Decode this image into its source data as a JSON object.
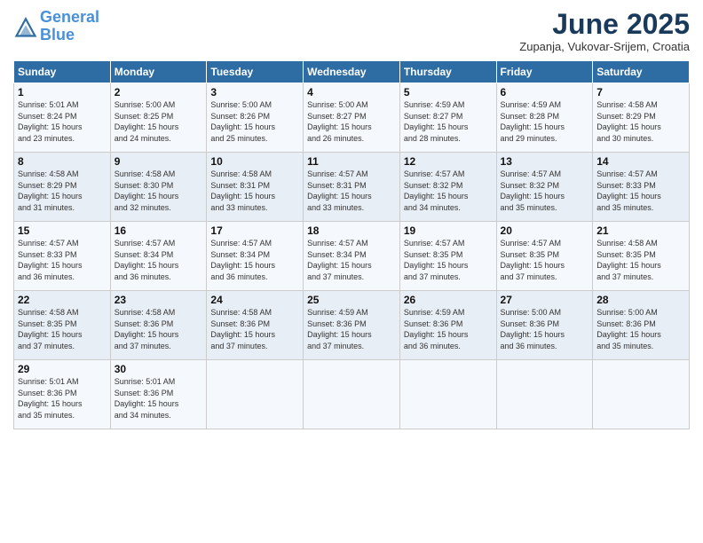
{
  "header": {
    "logo_line1": "General",
    "logo_line2": "Blue",
    "month": "June 2025",
    "location": "Zupanja, Vukovar-Srijem, Croatia"
  },
  "days_of_week": [
    "Sunday",
    "Monday",
    "Tuesday",
    "Wednesday",
    "Thursday",
    "Friday",
    "Saturday"
  ],
  "weeks": [
    [
      {
        "day": "1",
        "info": "Sunrise: 5:01 AM\nSunset: 8:24 PM\nDaylight: 15 hours\nand 23 minutes."
      },
      {
        "day": "2",
        "info": "Sunrise: 5:00 AM\nSunset: 8:25 PM\nDaylight: 15 hours\nand 24 minutes."
      },
      {
        "day": "3",
        "info": "Sunrise: 5:00 AM\nSunset: 8:26 PM\nDaylight: 15 hours\nand 25 minutes."
      },
      {
        "day": "4",
        "info": "Sunrise: 5:00 AM\nSunset: 8:27 PM\nDaylight: 15 hours\nand 26 minutes."
      },
      {
        "day": "5",
        "info": "Sunrise: 4:59 AM\nSunset: 8:27 PM\nDaylight: 15 hours\nand 28 minutes."
      },
      {
        "day": "6",
        "info": "Sunrise: 4:59 AM\nSunset: 8:28 PM\nDaylight: 15 hours\nand 29 minutes."
      },
      {
        "day": "7",
        "info": "Sunrise: 4:58 AM\nSunset: 8:29 PM\nDaylight: 15 hours\nand 30 minutes."
      }
    ],
    [
      {
        "day": "8",
        "info": "Sunrise: 4:58 AM\nSunset: 8:29 PM\nDaylight: 15 hours\nand 31 minutes."
      },
      {
        "day": "9",
        "info": "Sunrise: 4:58 AM\nSunset: 8:30 PM\nDaylight: 15 hours\nand 32 minutes."
      },
      {
        "day": "10",
        "info": "Sunrise: 4:58 AM\nSunset: 8:31 PM\nDaylight: 15 hours\nand 33 minutes."
      },
      {
        "day": "11",
        "info": "Sunrise: 4:57 AM\nSunset: 8:31 PM\nDaylight: 15 hours\nand 33 minutes."
      },
      {
        "day": "12",
        "info": "Sunrise: 4:57 AM\nSunset: 8:32 PM\nDaylight: 15 hours\nand 34 minutes."
      },
      {
        "day": "13",
        "info": "Sunrise: 4:57 AM\nSunset: 8:32 PM\nDaylight: 15 hours\nand 35 minutes."
      },
      {
        "day": "14",
        "info": "Sunrise: 4:57 AM\nSunset: 8:33 PM\nDaylight: 15 hours\nand 35 minutes."
      }
    ],
    [
      {
        "day": "15",
        "info": "Sunrise: 4:57 AM\nSunset: 8:33 PM\nDaylight: 15 hours\nand 36 minutes."
      },
      {
        "day": "16",
        "info": "Sunrise: 4:57 AM\nSunset: 8:34 PM\nDaylight: 15 hours\nand 36 minutes."
      },
      {
        "day": "17",
        "info": "Sunrise: 4:57 AM\nSunset: 8:34 PM\nDaylight: 15 hours\nand 36 minutes."
      },
      {
        "day": "18",
        "info": "Sunrise: 4:57 AM\nSunset: 8:34 PM\nDaylight: 15 hours\nand 37 minutes."
      },
      {
        "day": "19",
        "info": "Sunrise: 4:57 AM\nSunset: 8:35 PM\nDaylight: 15 hours\nand 37 minutes."
      },
      {
        "day": "20",
        "info": "Sunrise: 4:57 AM\nSunset: 8:35 PM\nDaylight: 15 hours\nand 37 minutes."
      },
      {
        "day": "21",
        "info": "Sunrise: 4:58 AM\nSunset: 8:35 PM\nDaylight: 15 hours\nand 37 minutes."
      }
    ],
    [
      {
        "day": "22",
        "info": "Sunrise: 4:58 AM\nSunset: 8:35 PM\nDaylight: 15 hours\nand 37 minutes."
      },
      {
        "day": "23",
        "info": "Sunrise: 4:58 AM\nSunset: 8:36 PM\nDaylight: 15 hours\nand 37 minutes."
      },
      {
        "day": "24",
        "info": "Sunrise: 4:58 AM\nSunset: 8:36 PM\nDaylight: 15 hours\nand 37 minutes."
      },
      {
        "day": "25",
        "info": "Sunrise: 4:59 AM\nSunset: 8:36 PM\nDaylight: 15 hours\nand 37 minutes."
      },
      {
        "day": "26",
        "info": "Sunrise: 4:59 AM\nSunset: 8:36 PM\nDaylight: 15 hours\nand 36 minutes."
      },
      {
        "day": "27",
        "info": "Sunrise: 5:00 AM\nSunset: 8:36 PM\nDaylight: 15 hours\nand 36 minutes."
      },
      {
        "day": "28",
        "info": "Sunrise: 5:00 AM\nSunset: 8:36 PM\nDaylight: 15 hours\nand 35 minutes."
      }
    ],
    [
      {
        "day": "29",
        "info": "Sunrise: 5:01 AM\nSunset: 8:36 PM\nDaylight: 15 hours\nand 35 minutes."
      },
      {
        "day": "30",
        "info": "Sunrise: 5:01 AM\nSunset: 8:36 PM\nDaylight: 15 hours\nand 34 minutes."
      },
      {
        "day": "",
        "info": ""
      },
      {
        "day": "",
        "info": ""
      },
      {
        "day": "",
        "info": ""
      },
      {
        "day": "",
        "info": ""
      },
      {
        "day": "",
        "info": ""
      }
    ]
  ]
}
